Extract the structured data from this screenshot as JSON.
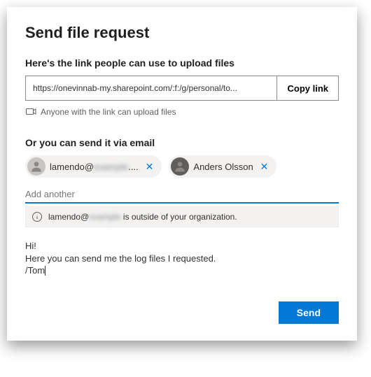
{
  "title": "Send file request",
  "link_section": {
    "heading": "Here's the link people can use to upload files",
    "url": "https://onevinnab-my.sharepoint.com/:f:/g/personal/to...",
    "copy_label": "Copy link",
    "permission_text": "Anyone with the link can upload files"
  },
  "email_section": {
    "heading": "Or you can send it via email",
    "recipients": [
      {
        "display_prefix": "lamendo@",
        "display_blur": "example",
        "display_suffix": "....",
        "has_photo": false
      },
      {
        "display": "Anders Olsson",
        "has_photo": true
      }
    ],
    "add_placeholder": "Add another",
    "warning_prefix": "lamendo@",
    "warning_blur": "example",
    "warning_suffix": " is outside of your organization.",
    "message": "Hi!\nHere you can send me the log files I requested.\n/Tom"
  },
  "send_label": "Send"
}
